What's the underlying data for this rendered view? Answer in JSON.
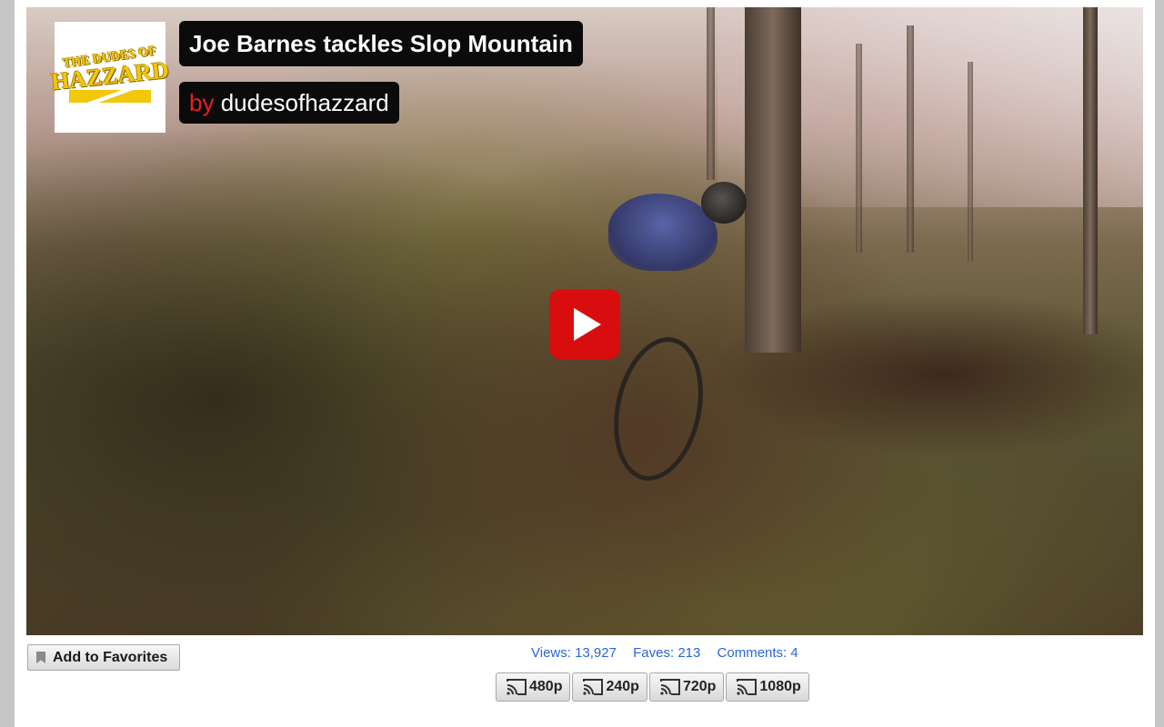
{
  "video": {
    "title": "Joe Barnes tackles Slop Mountain",
    "by_word": "by",
    "author": "dudesofhazzard",
    "play_icon": "play-icon",
    "logo": {
      "line1": "THE DUDES OF",
      "line2": "HAZZARD",
      "color": "#f2c70c"
    }
  },
  "actions": {
    "favorites_label": "Add to Favorites",
    "favorites_icon": "bookmark-icon"
  },
  "stats": {
    "views": "Views: 13,927",
    "faves": "Faves: 213",
    "comments": "Comments: 4",
    "link_color": "#2a66d4"
  },
  "resolutions": [
    {
      "label": "480p",
      "icon": "cast-icon"
    },
    {
      "label": "240p",
      "icon": "cast-icon"
    },
    {
      "label": "720p",
      "icon": "cast-icon"
    },
    {
      "label": "1080p",
      "icon": "cast-icon"
    }
  ],
  "colors": {
    "play_button": "#d80e0e",
    "author_prefix": "#e8201a"
  }
}
